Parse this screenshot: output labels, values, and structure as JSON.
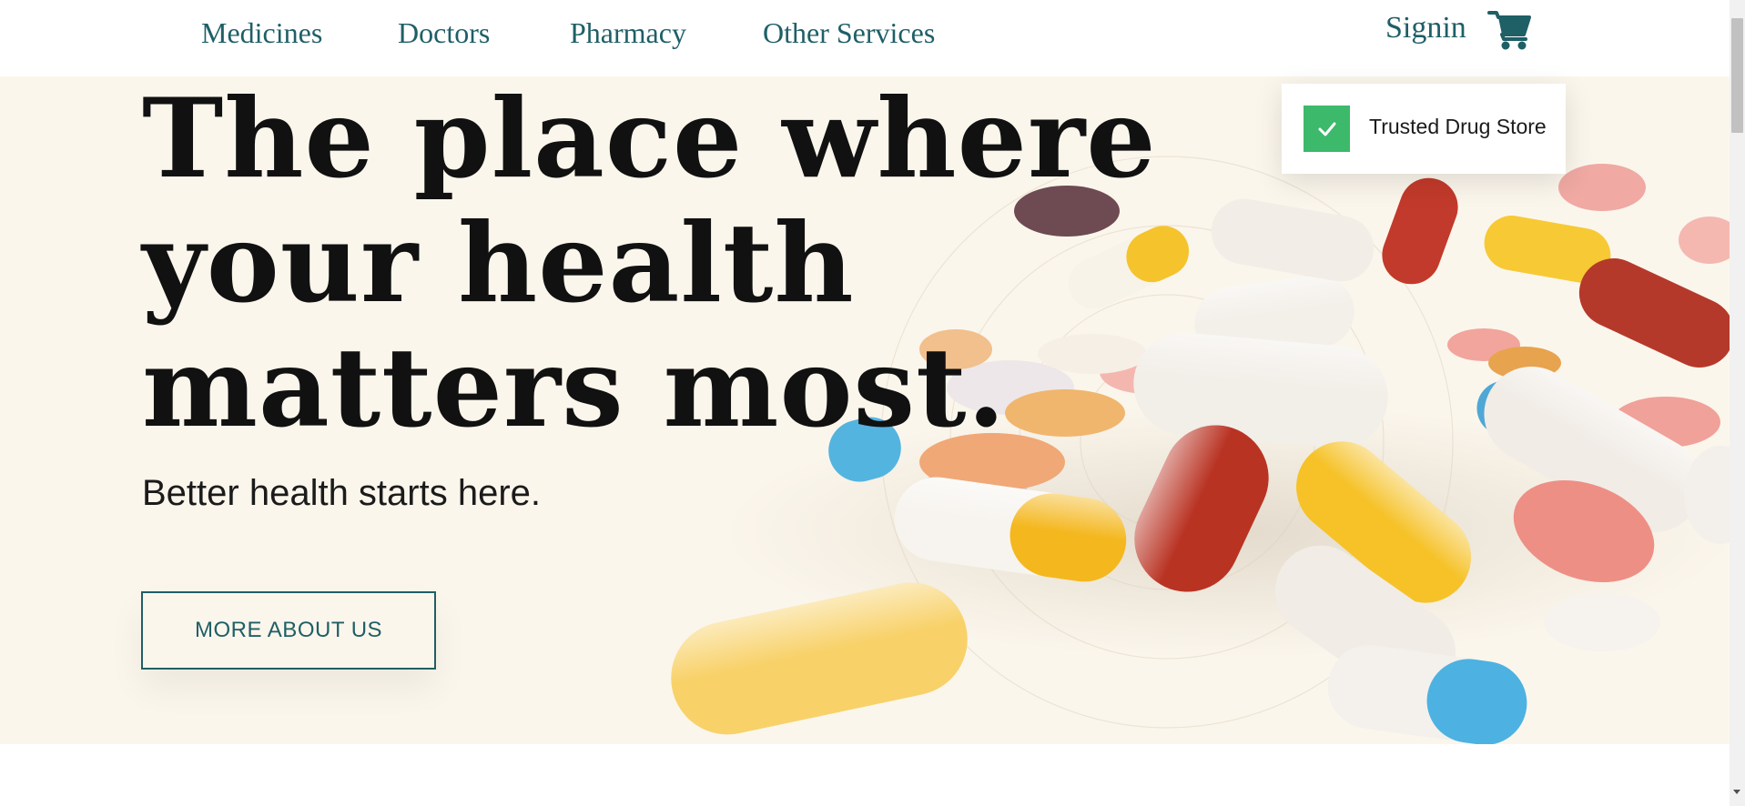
{
  "nav": {
    "items": [
      {
        "label": "Medicines"
      },
      {
        "label": "Doctors"
      },
      {
        "label": "Pharmacy"
      },
      {
        "label": "Other Services"
      }
    ],
    "signin_label": "Signin",
    "cart_icon": "cart-icon"
  },
  "hero": {
    "headline_lines": [
      "The place where",
      "your health",
      "matters most."
    ],
    "subtitle": "Better health starts here.",
    "button_label": "MORE ABOUT US",
    "image": "pills-capsules-pile"
  },
  "badge": {
    "text": "Trusted Drug Store",
    "icon": "check-icon"
  },
  "colors": {
    "accent": "#1f5f66",
    "hero_background": "#fbf6ec",
    "badge_check": "#3cb96a",
    "headline": "#111111"
  }
}
